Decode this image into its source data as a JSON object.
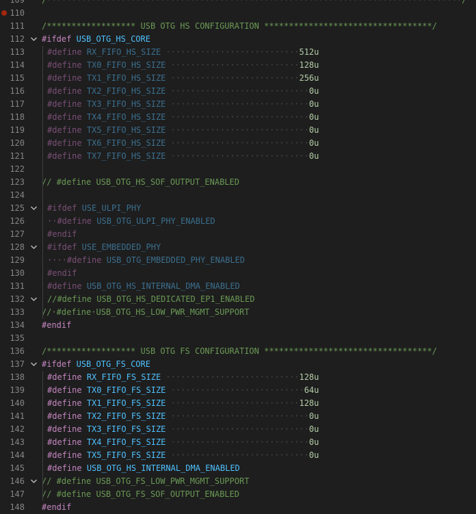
{
  "editor": {
    "colors": {
      "background": "#1e1e1e",
      "comment": "#6a9955",
      "directive": "#c586c0",
      "macro": "#4fc1ff",
      "number": "#b5cea8",
      "line_number": "#858585",
      "breakpoint": "#a1260d"
    },
    "lines": [
      {
        "n": "109",
        "tokens": [
          [
            "/************************************************************************************/",
            "c-comment"
          ]
        ],
        "partial": true
      },
      {
        "n": "110",
        "bp": true,
        "tokens": []
      },
      {
        "n": "111",
        "tokens": [
          [
            "/****************** USB OTG HS CONFIGURATION **********************************/",
            "c-comment"
          ]
        ]
      },
      {
        "n": "112",
        "fold": "open",
        "tokens": [
          [
            "#ifdef",
            "c-dir"
          ],
          [
            " ",
            "ws"
          ],
          [
            "USB_OTG_HS_CORE",
            "c-macro"
          ]
        ]
      },
      {
        "n": "113",
        "indent": 1,
        "tokens": [
          [
            "#define",
            "c-dir-dim"
          ],
          [
            " ",
            "ws"
          ],
          [
            "RX_FIFO_HS_SIZE",
            "c-macro-dim"
          ],
          [
            " ···························",
            "ws"
          ],
          [
            "512u",
            "c-num"
          ]
        ]
      },
      {
        "n": "114",
        "indent": 1,
        "tokens": [
          [
            "#define",
            "c-dir-dim"
          ],
          [
            " ",
            "ws"
          ],
          [
            "TX0_FIFO_HS_SIZE",
            "c-macro-dim"
          ],
          [
            " ··························",
            "ws"
          ],
          [
            "128u",
            "c-num"
          ]
        ]
      },
      {
        "n": "115",
        "indent": 1,
        "tokens": [
          [
            "#define",
            "c-dir-dim"
          ],
          [
            " ",
            "ws"
          ],
          [
            "TX1_FIFO_HS_SIZE",
            "c-macro-dim"
          ],
          [
            " ··························",
            "ws"
          ],
          [
            "256u",
            "c-num"
          ]
        ]
      },
      {
        "n": "116",
        "indent": 1,
        "tokens": [
          [
            "#define",
            "c-dir-dim"
          ],
          [
            " ",
            "ws"
          ],
          [
            "TX2_FIFO_HS_SIZE",
            "c-macro-dim"
          ],
          [
            " ····························",
            "ws"
          ],
          [
            "0u",
            "c-num"
          ]
        ]
      },
      {
        "n": "117",
        "indent": 1,
        "tokens": [
          [
            "#define",
            "c-dir-dim"
          ],
          [
            " ",
            "ws"
          ],
          [
            "TX3_FIFO_HS_SIZE",
            "c-macro-dim"
          ],
          [
            " ····························",
            "ws"
          ],
          [
            "0u",
            "c-num"
          ]
        ]
      },
      {
        "n": "118",
        "indent": 1,
        "tokens": [
          [
            "#define",
            "c-dir-dim"
          ],
          [
            " ",
            "ws"
          ],
          [
            "TX4_FIFO_HS_SIZE",
            "c-macro-dim"
          ],
          [
            " ····························",
            "ws"
          ],
          [
            "0u",
            "c-num"
          ]
        ]
      },
      {
        "n": "119",
        "indent": 1,
        "tokens": [
          [
            "#define",
            "c-dir-dim"
          ],
          [
            " ",
            "ws"
          ],
          [
            "TX5_FIFO_HS_SIZE",
            "c-macro-dim"
          ],
          [
            " ····························",
            "ws"
          ],
          [
            "0u",
            "c-num"
          ]
        ]
      },
      {
        "n": "120",
        "indent": 1,
        "tokens": [
          [
            "#define",
            "c-dir-dim"
          ],
          [
            " ",
            "ws"
          ],
          [
            "TX6_FIFO_HS_SIZE",
            "c-macro-dim"
          ],
          [
            " ····························",
            "ws"
          ],
          [
            "0u",
            "c-num"
          ]
        ]
      },
      {
        "n": "121",
        "indent": 1,
        "tokens": [
          [
            "#define",
            "c-dir-dim"
          ],
          [
            " ",
            "ws"
          ],
          [
            "TX7_FIFO_HS_SIZE",
            "c-macro-dim"
          ],
          [
            " ····························",
            "ws"
          ],
          [
            "0u",
            "c-num"
          ]
        ]
      },
      {
        "n": "122",
        "tokens": []
      },
      {
        "n": "123",
        "tokens": [
          [
            "// #define USB_OTG_HS_SOF_OUTPUT_ENABLED",
            "c-comment"
          ]
        ]
      },
      {
        "n": "124",
        "tokens": []
      },
      {
        "n": "125",
        "fold": "open",
        "indent": 1,
        "tokens": [
          [
            "#ifdef",
            "c-dir-dim"
          ],
          [
            " ",
            "ws"
          ],
          [
            "USE_ULPI_PHY",
            "c-macro-dim"
          ]
        ]
      },
      {
        "n": "126",
        "indent": 1,
        "tokens": [
          [
            "··#define",
            "c-dir-dim"
          ],
          [
            " ",
            "ws"
          ],
          [
            "USB_OTG_ULPI_PHY_ENABLED",
            "c-macro-dim"
          ]
        ]
      },
      {
        "n": "127",
        "indent": 1,
        "tokens": [
          [
            "#endif",
            "c-dir-dim"
          ]
        ]
      },
      {
        "n": "128",
        "fold": "open",
        "indent": 1,
        "tokens": [
          [
            "#ifdef",
            "c-dir-dim"
          ],
          [
            " ",
            "ws"
          ],
          [
            "USE_EMBEDDED_PHY",
            "c-macro-dim"
          ]
        ]
      },
      {
        "n": "129",
        "indent": 1,
        "tokens": [
          [
            "····#define",
            "c-dir-dim"
          ],
          [
            " ",
            "ws"
          ],
          [
            "USB_OTG_EMBEDDED_PHY_ENABLED",
            "c-macro-dim"
          ]
        ]
      },
      {
        "n": "130",
        "indent": 1,
        "tokens": [
          [
            "#endif",
            "c-dir-dim"
          ]
        ]
      },
      {
        "n": "131",
        "indent": 1,
        "tokens": [
          [
            "#define",
            "c-dir-dim"
          ],
          [
            " ",
            "ws"
          ],
          [
            "USB_OTG_HS_INTERNAL_DMA_ENABLED",
            "c-macro-dim"
          ]
        ]
      },
      {
        "n": "132",
        "fold": "open",
        "indent": 1,
        "tokens": [
          [
            "//#define USB_OTG_HS_DEDICATED_EP1_ENABLED",
            "c-comment"
          ]
        ]
      },
      {
        "n": "133",
        "tokens": [
          [
            "//·#define·USB_OTG_HS_LOW_PWR_MGMT_SUPPORT",
            "c-comment"
          ]
        ]
      },
      {
        "n": "134",
        "tokens": [
          [
            "#endif",
            "c-dir"
          ]
        ]
      },
      {
        "n": "135",
        "tokens": []
      },
      {
        "n": "136",
        "tokens": [
          [
            "/****************** USB OTG FS CONFIGURATION **********************************/",
            "c-comment"
          ]
        ]
      },
      {
        "n": "137",
        "fold": "open",
        "tokens": [
          [
            "#ifdef",
            "c-dir"
          ],
          [
            " ",
            "ws"
          ],
          [
            "USB_OTG_FS_CORE",
            "c-macro"
          ]
        ]
      },
      {
        "n": "138",
        "indent": 1,
        "tokens": [
          [
            "#define",
            "c-dir"
          ],
          [
            " ",
            "ws"
          ],
          [
            "RX_FIFO_FS_SIZE",
            "c-macro"
          ],
          [
            " ···························",
            "ws"
          ],
          [
            "128u",
            "c-num"
          ]
        ]
      },
      {
        "n": "139",
        "indent": 1,
        "tokens": [
          [
            "#define",
            "c-dir"
          ],
          [
            " ",
            "ws"
          ],
          [
            "TX0_FIFO_FS_SIZE",
            "c-macro"
          ],
          [
            " ···························",
            "ws"
          ],
          [
            "64u",
            "c-num"
          ]
        ]
      },
      {
        "n": "140",
        "indent": 1,
        "tokens": [
          [
            "#define",
            "c-dir"
          ],
          [
            " ",
            "ws"
          ],
          [
            "TX1_FIFO_FS_SIZE",
            "c-macro"
          ],
          [
            " ··························",
            "ws"
          ],
          [
            "128u",
            "c-num"
          ]
        ]
      },
      {
        "n": "141",
        "indent": 1,
        "tokens": [
          [
            "#define",
            "c-dir"
          ],
          [
            " ",
            "ws"
          ],
          [
            "TX2_FIFO_FS_SIZE",
            "c-macro"
          ],
          [
            " ····························",
            "ws"
          ],
          [
            "0u",
            "c-num"
          ]
        ]
      },
      {
        "n": "142",
        "indent": 1,
        "tokens": [
          [
            "#define",
            "c-dir"
          ],
          [
            " ",
            "ws"
          ],
          [
            "TX3_FIFO_FS_SIZE",
            "c-macro"
          ],
          [
            " ····························",
            "ws"
          ],
          [
            "0u",
            "c-num"
          ]
        ]
      },
      {
        "n": "143",
        "indent": 1,
        "tokens": [
          [
            "#define",
            "c-dir"
          ],
          [
            " ",
            "ws"
          ],
          [
            "TX4_FIFO_FS_SIZE",
            "c-macro"
          ],
          [
            " ····························",
            "ws"
          ],
          [
            "0u",
            "c-num"
          ]
        ]
      },
      {
        "n": "144",
        "indent": 1,
        "tokens": [
          [
            "#define",
            "c-dir"
          ],
          [
            " ",
            "ws"
          ],
          [
            "TX5_FIFO_FS_SIZE",
            "c-macro"
          ],
          [
            " ····························",
            "ws"
          ],
          [
            "0u",
            "c-num"
          ]
        ]
      },
      {
        "n": "145",
        "indent": 1,
        "tokens": [
          [
            "#define",
            "c-dir"
          ],
          [
            " ",
            "ws"
          ],
          [
            "USB_OTG_HS_INTERNAL_DMA_ENABLED",
            "c-macro"
          ]
        ]
      },
      {
        "n": "146",
        "fold": "open",
        "tokens": [
          [
            "// #define USB_OTG_FS_LOW_PWR_MGMT_SUPPORT",
            "c-comment"
          ]
        ]
      },
      {
        "n": "147",
        "tokens": [
          [
            "// #define USB_OTG_FS_SOF_OUTPUT_ENABLED",
            "c-comment"
          ]
        ]
      },
      {
        "n": "148",
        "tokens": [
          [
            "#endif",
            "c-dir"
          ]
        ]
      }
    ]
  }
}
